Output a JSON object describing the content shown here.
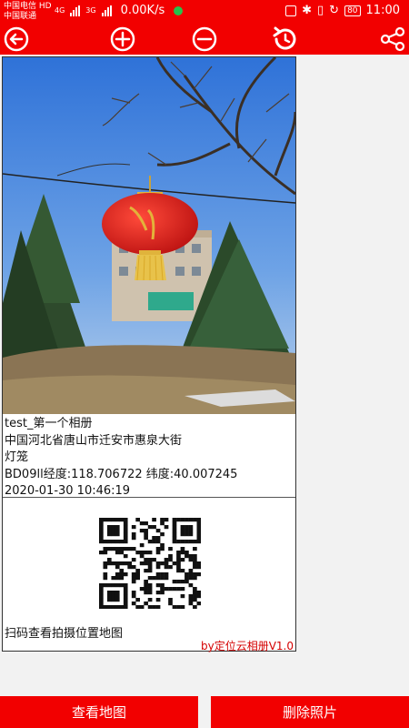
{
  "status_bar": {
    "carrier_line1": "中国电信 HD",
    "carrier_line2": "中国联通",
    "network_1": "4G",
    "network_2": "3G",
    "net_speed": "0.00K/s",
    "battery": "80",
    "time": "11:00"
  },
  "toolbar": {
    "icons": [
      "back-icon",
      "zoom-in-icon",
      "zoom-out-icon",
      "rotate-icon",
      "share-icon"
    ]
  },
  "photo": {
    "album": "test_第一个相册",
    "address": "中国河北省唐山市迁安市惠泉大街",
    "keyword": "灯笼",
    "coordinates": "BD09ll经度:118.706722 纬度:40.007245",
    "datetime": "2020-01-30 10:46:19"
  },
  "qr": {
    "label": "扫码查看拍摄位置地图"
  },
  "credit": "by定位云相册V1.0",
  "buttons": {
    "view_map": "查看地图",
    "delete_photo": "删除照片"
  },
  "colors": {
    "brand_red": "#f20000",
    "credit_red": "#d40000"
  }
}
